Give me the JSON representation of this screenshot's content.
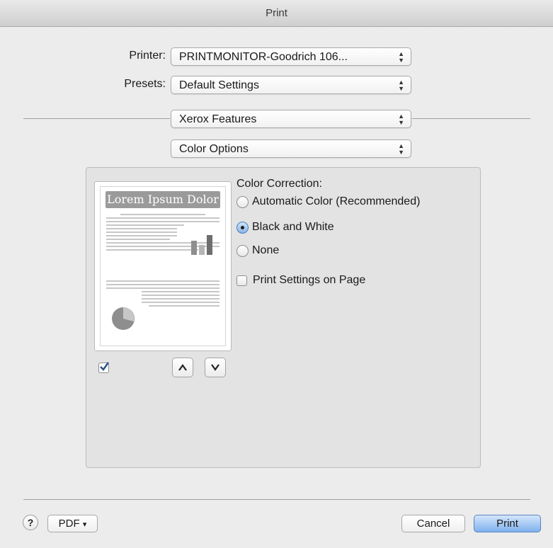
{
  "window": {
    "title": "Print"
  },
  "printer": {
    "label": "Printer:",
    "value": "PRINTMONITOR-Goodrich 106..."
  },
  "presets": {
    "label": "Presets:",
    "value": "Default Settings"
  },
  "section_menu": {
    "value": "Xerox Features"
  },
  "subsection_menu": {
    "value": "Color Options"
  },
  "preview": {
    "heading": "Lorem Ipsum Dolor",
    "checkbox_checked": true,
    "up_label": "^",
    "down_label": "v"
  },
  "color_correction": {
    "label": "Color Correction:",
    "options": [
      {
        "label": "Automatic Color (Recommended)",
        "selected": false
      },
      {
        "label": "Black and White",
        "selected": true
      },
      {
        "label": "None",
        "selected": false
      }
    ]
  },
  "print_settings_on_page": {
    "label": "Print Settings on Page",
    "checked": false
  },
  "footer": {
    "help_label": "?",
    "pdf_label": "PDF",
    "pdf_arrow": "▾",
    "cancel_label": "Cancel",
    "print_label": "Print"
  },
  "colors": {
    "accent": "#7fb1ee",
    "panel": "#e3e3e3",
    "window": "#ececec"
  }
}
